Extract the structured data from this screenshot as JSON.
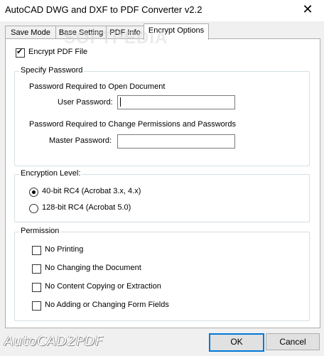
{
  "window": {
    "title": "AutoCAD DWG and DXF to PDF Converter v2.2",
    "close_glyph": "✕"
  },
  "tabs": [
    {
      "label": "Save Mode"
    },
    {
      "label": "Base Setting"
    },
    {
      "label": "PDF Info"
    },
    {
      "label": "Encrypt Options"
    }
  ],
  "active_tab": "Encrypt Options",
  "encrypt": {
    "label": "Encrypt PDF File",
    "checked": true
  },
  "password_group": {
    "title": "Specify Password",
    "open_heading": "Password Required to Open Document",
    "user_label": "User Password:",
    "user_value": "",
    "change_heading": "Password Required to Change Permissions and Passwords",
    "master_label": "Master Password:",
    "master_value": ""
  },
  "encryption_group": {
    "title": "Encryption Level:",
    "options": [
      {
        "label": "40-bit RC4 (Acrobat 3.x, 4.x)",
        "selected": true
      },
      {
        "label": "128-bit RC4 (Acrobat 5.0)",
        "selected": false
      }
    ]
  },
  "permission_group": {
    "title": "Permission",
    "items": [
      {
        "label": "No Printing",
        "checked": false
      },
      {
        "label": "No Changing the Document",
        "checked": false
      },
      {
        "label": "No Content Copying or Extraction",
        "checked": false
      },
      {
        "label": "No Adding or Changing Form Fields",
        "checked": false
      }
    ]
  },
  "footer": {
    "logo_text": "AutoCAD2PDF",
    "ok_label": "OK",
    "cancel_label": "Cancel"
  },
  "watermark": "SOFTPEDIA",
  "colors": {
    "focus_border": "#0078d7"
  }
}
